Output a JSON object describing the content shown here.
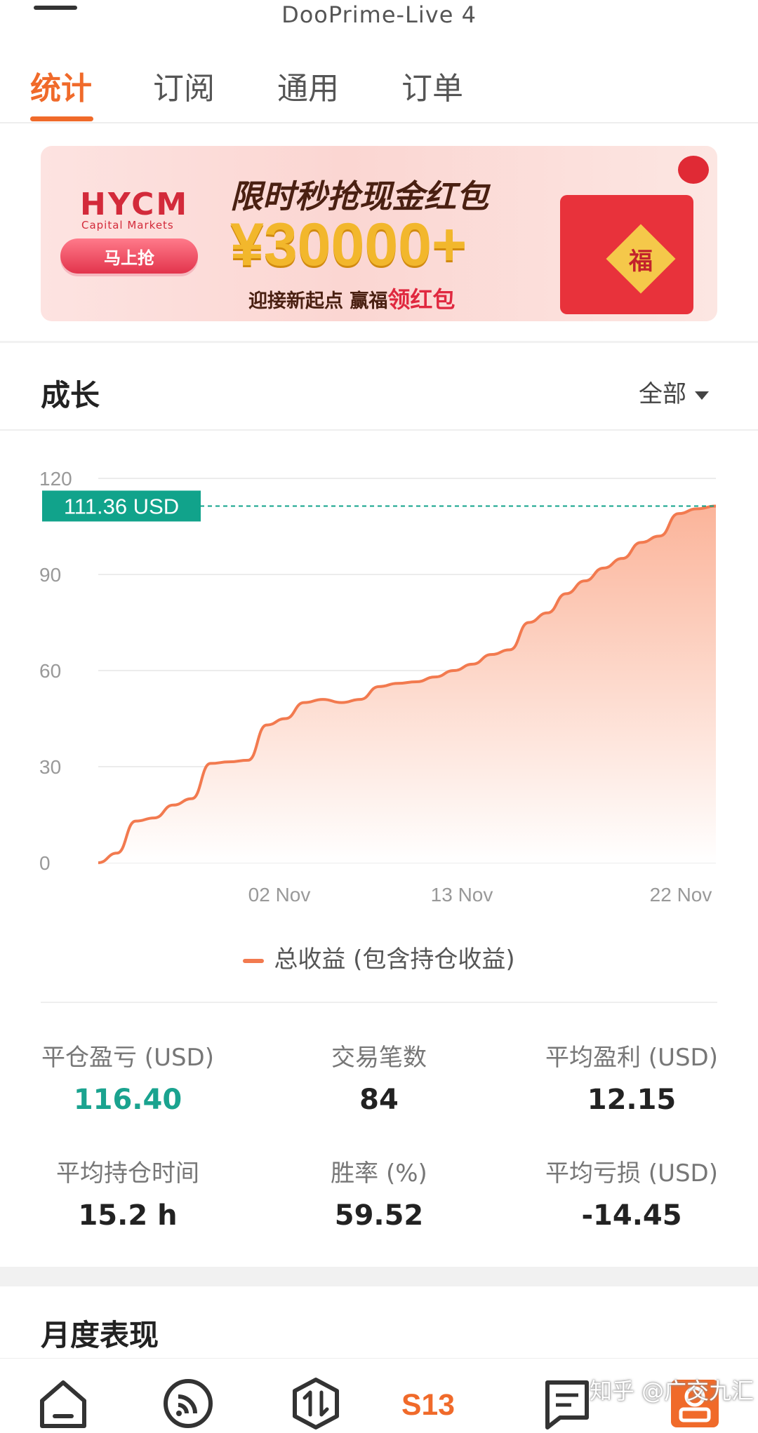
{
  "app": {
    "title": "DooPrime-Live 4"
  },
  "tabs": [
    {
      "label": "统计",
      "active": true
    },
    {
      "label": "订阅",
      "active": false
    },
    {
      "label": "通用",
      "active": false
    },
    {
      "label": "订单",
      "active": false
    }
  ],
  "banner": {
    "brand": "HYCM",
    "brand_sub": "Capital Markets",
    "button_label": "马上抢",
    "title": "限时秒抢现金红包",
    "amount": "¥30000+",
    "subtitle_prefix": "迎接新起点 赢福",
    "subtitle_highlight": "领红包",
    "envelope_char": "福"
  },
  "growth": {
    "title": "成长",
    "range_label": "全部"
  },
  "chart_data": {
    "type": "area",
    "y_ticks": [
      "0",
      "30",
      "60",
      "90",
      "120"
    ],
    "ylim": [
      0,
      120
    ],
    "x_tick_labels": [
      "02 Nov",
      "13 Nov",
      "22 Nov"
    ],
    "current_value_label": "111.36 USD",
    "current_value": 111.36,
    "series": [
      {
        "name": "总收益 (包含持仓收益)",
        "values": [
          0,
          3,
          13,
          14,
          18,
          20,
          31,
          31.5,
          32,
          43,
          45,
          50,
          51,
          50,
          51,
          55,
          56,
          56.5,
          58,
          60,
          62,
          65,
          66.5,
          75,
          78,
          84,
          88,
          92,
          95,
          100,
          102,
          109,
          110.5,
          111.36
        ]
      }
    ],
    "colors": {
      "line": "#f27a4f",
      "fill_top": "#fbb49a",
      "fill_bottom": "#ffffff",
      "marker": "#11a38b"
    },
    "grid": true
  },
  "legend": {
    "label": "总收益 (包含持仓收益)"
  },
  "stats": [
    {
      "label": "平仓盈亏 (USD)",
      "value": "116.40",
      "color": "#1aa38f"
    },
    {
      "label": "交易笔数",
      "value": "84"
    },
    {
      "label": "平均盈利 (USD)",
      "value": "12.15"
    },
    {
      "label": "平均持仓时间",
      "value": "15.2 h"
    },
    {
      "label": "胜率 (%)",
      "value": "59.52"
    },
    {
      "label": "平均亏损 (USD)",
      "value": "-14.45"
    }
  ],
  "monthly": {
    "title": "月度表现"
  },
  "bottom_nav": [
    {
      "icon": "home-icon"
    },
    {
      "icon": "feed-icon"
    },
    {
      "icon": "trade-icon"
    },
    {
      "icon": "s13-logo",
      "label": "S13"
    },
    {
      "icon": "message-icon"
    },
    {
      "icon": "profile-icon"
    }
  ],
  "watermark": "知乎 @广交九汇"
}
